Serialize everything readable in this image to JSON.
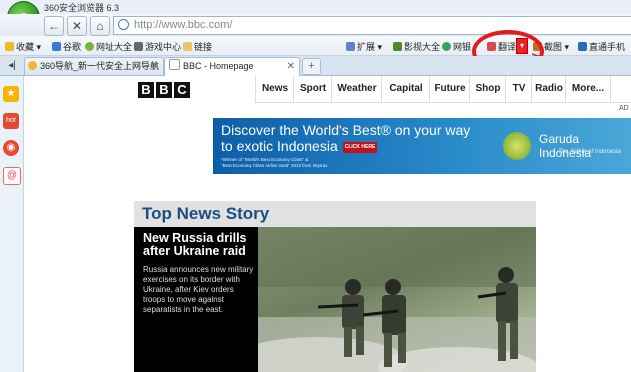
{
  "browser": {
    "title": "360安全浏览器 6.3",
    "logo_letter": "e",
    "address": "http://www.bbc.com/",
    "nav": {
      "back": "←",
      "close": "✕",
      "home": "⌂"
    }
  },
  "bookmarks": {
    "left": [
      "收藏",
      "谷歌",
      "网址大全",
      "游戏中心",
      "链接"
    ],
    "right": [
      "扩展",
      "影视大全",
      "网银",
      "翻译",
      "截图",
      "直通手机"
    ]
  },
  "tabs": [
    {
      "label": "360导航_新一代安全上网导航",
      "active": false
    },
    {
      "label": "BBC - Homepage",
      "active": true
    }
  ],
  "sidebar": [
    "star-icon",
    "hot-icon",
    "weibo-icon",
    "mail-icon"
  ],
  "bbc": {
    "logo": [
      "B",
      "B",
      "C"
    ],
    "nav": [
      "News",
      "Sport",
      "Weather",
      "Capital",
      "Future",
      "Shop",
      "TV",
      "Radio",
      "More..."
    ],
    "ad_label": "AD",
    "ad": {
      "headline_1": "Discover the World's Best® on your way",
      "headline_2": "to exotic Indonesia",
      "fine_1": "*Winner of \"World's Best Economy Class\" &",
      "fine_2": "\"Best Economy Class Airline Seat\" 2013 from Skytrax",
      "button": "CLICK HERE",
      "brand": "Garuda Indonesia",
      "tagline": "The Airline of Indonesia"
    },
    "top_story_heading": "Top News Story",
    "story": {
      "title": "New Russia drills after Ukraine raid",
      "summary": "Russia announces new military exercises on its border with Ukraine, after Kiev orders troops to move against separatists in the east."
    }
  },
  "colors": {
    "annotation": "#e01b1b",
    "bbc_blue": "#1a4f7d"
  }
}
